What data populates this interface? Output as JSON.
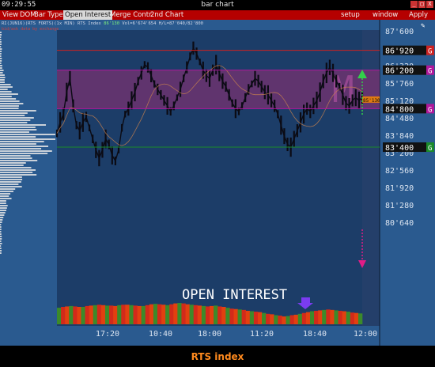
{
  "window": {
    "clock": "09:29:55",
    "title": "bar chart",
    "controls": [
      "_",
      "□",
      "X"
    ]
  },
  "menu": {
    "items": [
      "View",
      "DOM",
      "Bar Type",
      "Open Interest",
      "Merge Contr",
      "2nd Chart"
    ],
    "active": "Open Interest",
    "right_items": [
      "setup",
      "window",
      "Apply"
    ]
  },
  "chart_header": {
    "symbol_info": "RI(JUN16)(RTS FORTS)(1x MIN) RTS Index",
    "price": "86'130",
    "stats": "Vol=6'674'654 H/L=87'040/82'800",
    "sub_info": "bid/ask data by exchange"
  },
  "chart_data": {
    "type": "line",
    "title": "RTS index",
    "annotation": "OPEN INTEREST",
    "y_tick_labels": [
      "87'600",
      "86'960",
      "86'320",
      "85'760",
      "85'120",
      "84'480",
      "83'840",
      "83'200",
      "82'560",
      "81'920",
      "81'280",
      "80'640"
    ],
    "x_tick_labels": [
      "17:20",
      "10:40",
      "18:00",
      "11:20",
      "18:40",
      "12:00"
    ],
    "price_levels": [
      {
        "label": "86'920",
        "marker": "G",
        "color": "#cc2222"
      },
      {
        "label": "86'200",
        "marker": "G",
        "color": "#b0189a"
      },
      {
        "label": "84'800",
        "marker": "G",
        "color": "#b0189a"
      },
      {
        "label": "83'400",
        "marker": "G",
        "color": "#1a8a2a"
      }
    ],
    "current_price_tag": "85'130",
    "y_range": [
      80200,
      87900
    ],
    "price_series": [
      83900,
      84300,
      84600,
      85400,
      85900,
      84900,
      84200,
      84000,
      84300,
      84500,
      84100,
      83700,
      83300,
      83000,
      83300,
      83700,
      83500,
      83100,
      82900,
      83300,
      84100,
      84600,
      84800,
      85100,
      85400,
      85800,
      86100,
      86400,
      86300,
      86000,
      85700,
      85500,
      85300,
      85100,
      84900,
      84700,
      84900,
      85200,
      85500,
      85900,
      86300,
      86700,
      87000,
      86800,
      86500,
      86200,
      86000,
      85900,
      86200,
      86400,
      86100,
      85800,
      85600,
      85300,
      85000,
      84800,
      84700,
      84900,
      85200,
      85500,
      85700,
      85900,
      85800,
      85600,
      85400,
      85300,
      85100,
      84900,
      84600,
      84200,
      83800,
      83500,
      83400,
      83700,
      84000,
      84300,
      84600,
      84800,
      84700,
      84900,
      85100,
      85400,
      85800,
      86100,
      86300,
      86100,
      85800,
      85600,
      85300,
      85000,
      84900,
      85100,
      85200,
      85100,
      85200
    ],
    "oi_series": [
      38,
      40,
      41,
      42,
      41,
      40,
      40,
      42,
      43,
      44,
      45,
      44,
      43,
      43,
      42,
      44,
      45,
      45,
      44,
      43,
      42,
      42,
      44,
      46,
      47,
      46,
      45,
      44,
      46,
      48,
      49,
      48,
      46,
      45,
      44,
      43,
      42,
      41,
      42,
      43,
      41,
      40,
      38,
      36,
      35,
      34,
      33,
      31,
      30,
      29,
      28,
      26,
      24,
      23,
      21,
      20,
      18,
      19,
      21,
      22,
      24,
      26,
      28,
      30,
      31,
      32,
      33,
      34,
      33,
      32,
      31,
      30,
      29,
      27,
      26,
      25
    ]
  },
  "colors": {
    "background": "#2a5a8f",
    "session_shade": "#1c3d68",
    "value_band": "#8a2f72",
    "price_line": "#0b0b14",
    "arrow_up": "#33d14a",
    "arrow_down": "#e21c86"
  }
}
